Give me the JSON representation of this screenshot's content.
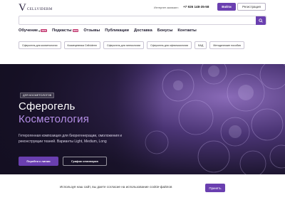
{
  "header": {
    "logo_letter": "V",
    "logo_text": "CELLVIDERM",
    "shop_label": "Интернет-магазин:",
    "phone": "+7 926 148-35-58",
    "login_label": "Войти",
    "register_label": "Регистрация"
  },
  "search": {
    "placeholder": "",
    "icon": "search-icon"
  },
  "nav": {
    "items": [
      {
        "label": "Обучение",
        "badge": "NEW",
        "chevron": true
      },
      {
        "label": "Подкасты",
        "badge": "NEW",
        "chevron": false
      },
      {
        "label": "Отзывы",
        "badge": "",
        "chevron": false
      },
      {
        "label": "Публикации",
        "badge": "",
        "chevron": false
      },
      {
        "label": "Доставка",
        "badge": "",
        "chevron": false
      },
      {
        "label": "Бонусы",
        "badge": "",
        "chevron": false
      },
      {
        "label": "Контакты",
        "badge": "",
        "chevron": false
      }
    ]
  },
  "tags": [
    "Сферогель для косметологии",
    "Космецевтика Cellviderm",
    "Сферогель для гинекологии",
    "Сферогель для офтальмологии",
    "БАД",
    "Методические пособия"
  ],
  "hero": {
    "chip": "ДЛЯ КОСМЕТОЛОГОВ",
    "title": "Сферогель",
    "subtitle": "Косметология",
    "description": "Гетерогенная композиция для биорегенерации, омоложения и реконструкции тканей. Варианты Light, Medium, Long",
    "primary_button": "Перейти к линии",
    "secondary_button": "График семинаров"
  },
  "cookie": {
    "text": "Используя наш сайт, вы даете согласие на использование cookie-файлов",
    "accept_label": "Принять"
  },
  "colors": {
    "accent": "#6a3fb0",
    "badge": "#c0306a",
    "hero_subtitle": "#b48ee6",
    "hero_bg": "#1f1733"
  }
}
